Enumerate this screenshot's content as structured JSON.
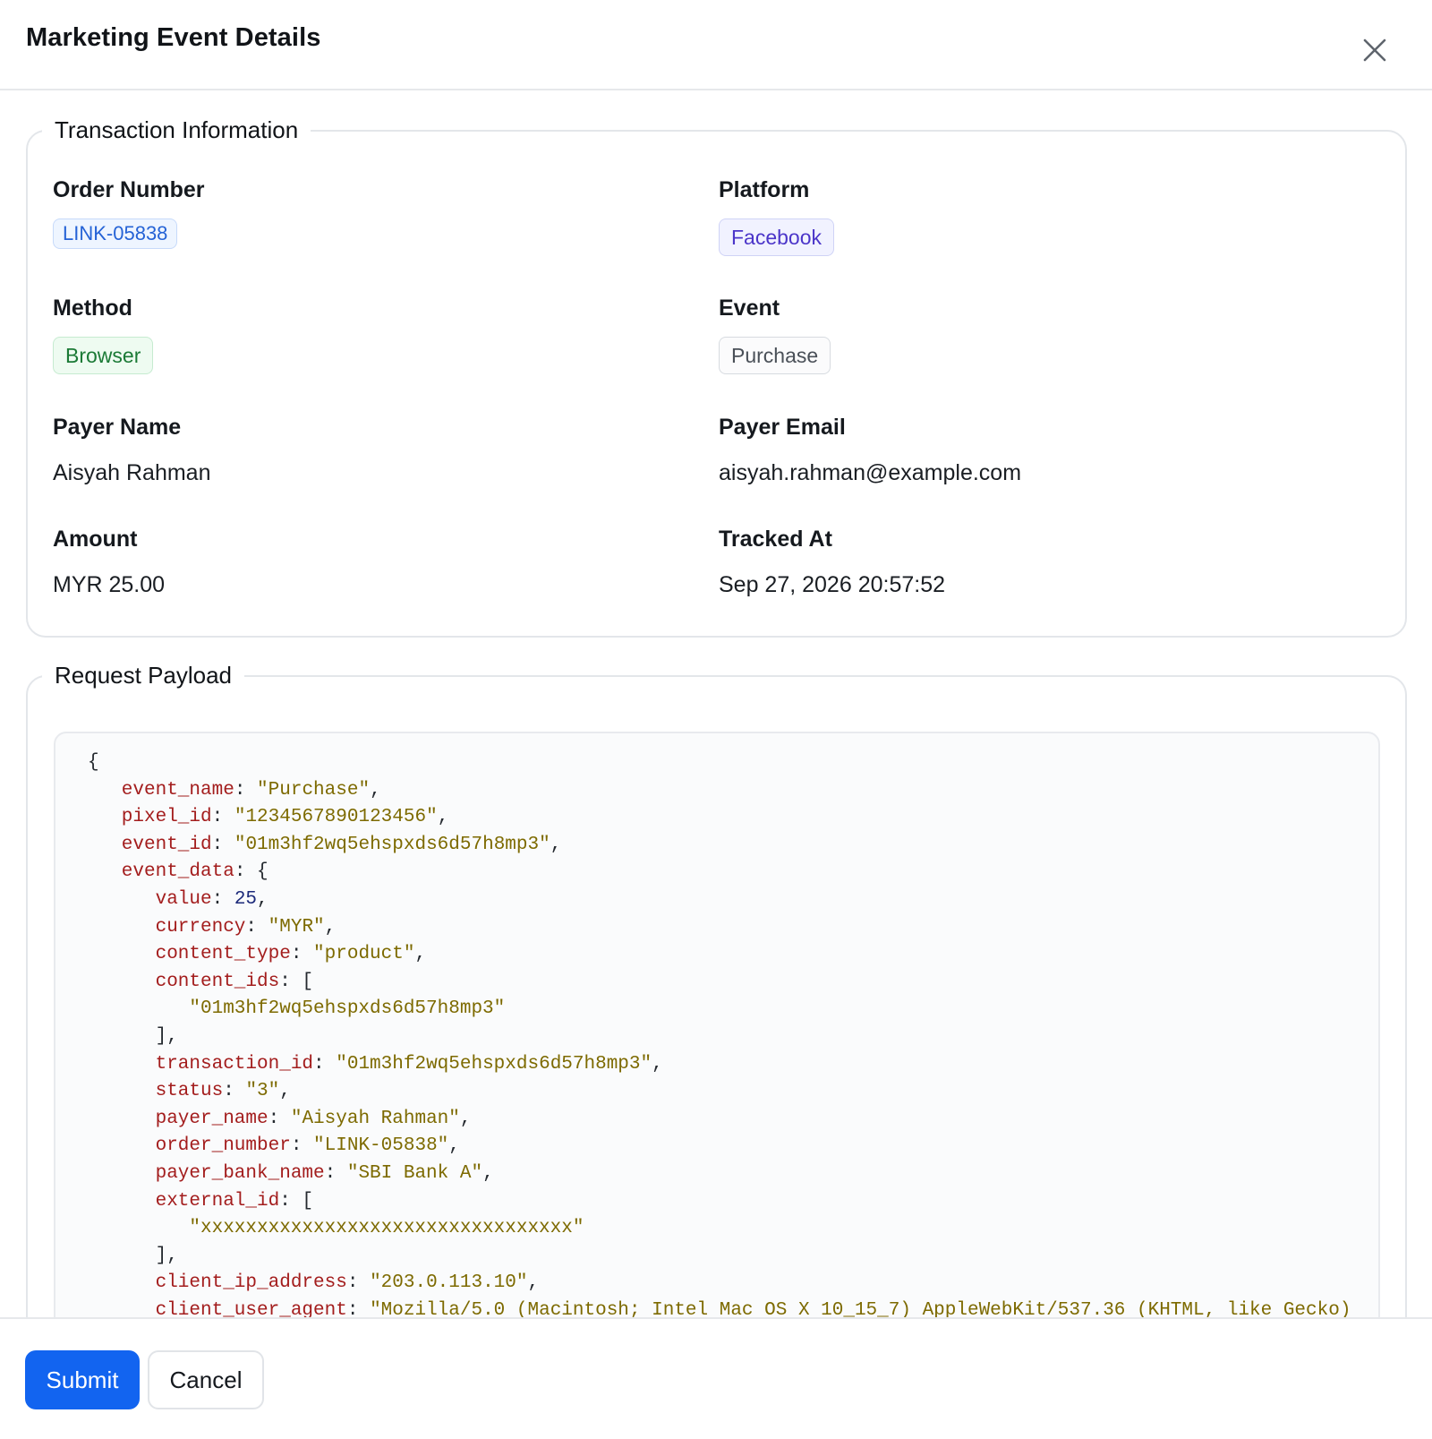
{
  "modal": {
    "title": "Marketing Event Details"
  },
  "transaction": {
    "legend": "Transaction Information",
    "order_number": {
      "label": "Order Number",
      "value": "LINK-05838"
    },
    "platform": {
      "label": "Platform",
      "value": "Facebook"
    },
    "method": {
      "label": "Method",
      "value": "Browser"
    },
    "event": {
      "label": "Event",
      "value": "Purchase"
    },
    "payer_name": {
      "label": "Payer Name",
      "value": "Aisyah Rahman"
    },
    "payer_email": {
      "label": "Payer Email",
      "value": "aisyah.rahman@example.com"
    },
    "amount": {
      "label": "Amount",
      "value": "MYR 25.00"
    },
    "tracked_at": {
      "label": "Tracked At",
      "value": "Sep 27, 2026 20:57:52"
    }
  },
  "payload": {
    "legend": "Request Payload",
    "lines": [
      {
        "indent": 0,
        "parts": [
          [
            "p",
            "{"
          ]
        ]
      },
      {
        "indent": 1,
        "parts": [
          [
            "k",
            "event_name"
          ],
          [
            "p",
            ": "
          ],
          [
            "s",
            "\"Purchase\""
          ],
          [
            "p",
            ","
          ]
        ]
      },
      {
        "indent": 1,
        "parts": [
          [
            "k",
            "pixel_id"
          ],
          [
            "p",
            ": "
          ],
          [
            "s",
            "\"1234567890123456\""
          ],
          [
            "p",
            ","
          ]
        ]
      },
      {
        "indent": 1,
        "parts": [
          [
            "k",
            "event_id"
          ],
          [
            "p",
            ": "
          ],
          [
            "s",
            "\"01m3hf2wq5ehspxds6d57h8mp3\""
          ],
          [
            "p",
            ","
          ]
        ]
      },
      {
        "indent": 1,
        "parts": [
          [
            "k",
            "event_data"
          ],
          [
            "p",
            ": {"
          ]
        ]
      },
      {
        "indent": 2,
        "parts": [
          [
            "k",
            "value"
          ],
          [
            "p",
            ": "
          ],
          [
            "n",
            "25"
          ],
          [
            "p",
            ","
          ]
        ]
      },
      {
        "indent": 2,
        "parts": [
          [
            "k",
            "currency"
          ],
          [
            "p",
            ": "
          ],
          [
            "s",
            "\"MYR\""
          ],
          [
            "p",
            ","
          ]
        ]
      },
      {
        "indent": 2,
        "parts": [
          [
            "k",
            "content_type"
          ],
          [
            "p",
            ": "
          ],
          [
            "s",
            "\"product\""
          ],
          [
            "p",
            ","
          ]
        ]
      },
      {
        "indent": 2,
        "parts": [
          [
            "k",
            "content_ids"
          ],
          [
            "p",
            ": ["
          ]
        ]
      },
      {
        "indent": 3,
        "parts": [
          [
            "s",
            "\"01m3hf2wq5ehspxds6d57h8mp3\""
          ]
        ]
      },
      {
        "indent": 2,
        "parts": [
          [
            "p",
            "],"
          ]
        ]
      },
      {
        "indent": 2,
        "parts": [
          [
            "k",
            "transaction_id"
          ],
          [
            "p",
            ": "
          ],
          [
            "s",
            "\"01m3hf2wq5ehspxds6d57h8mp3\""
          ],
          [
            "p",
            ","
          ]
        ]
      },
      {
        "indent": 2,
        "parts": [
          [
            "k",
            "status"
          ],
          [
            "p",
            ": "
          ],
          [
            "s",
            "\"3\""
          ],
          [
            "p",
            ","
          ]
        ]
      },
      {
        "indent": 2,
        "parts": [
          [
            "k",
            "payer_name"
          ],
          [
            "p",
            ": "
          ],
          [
            "s",
            "\"Aisyah Rahman\""
          ],
          [
            "p",
            ","
          ]
        ]
      },
      {
        "indent": 2,
        "parts": [
          [
            "k",
            "order_number"
          ],
          [
            "p",
            ": "
          ],
          [
            "s",
            "\"LINK-05838\""
          ],
          [
            "p",
            ","
          ]
        ]
      },
      {
        "indent": 2,
        "parts": [
          [
            "k",
            "payer_bank_name"
          ],
          [
            "p",
            ": "
          ],
          [
            "s",
            "\"SBI Bank A\""
          ],
          [
            "p",
            ","
          ]
        ]
      },
      {
        "indent": 2,
        "parts": [
          [
            "k",
            "external_id"
          ],
          [
            "p",
            ": ["
          ]
        ]
      },
      {
        "indent": 3,
        "parts": [
          [
            "s",
            "\"xxxxxxxxxxxxxxxxxxxxxxxxxxxxxxxxx\""
          ]
        ]
      },
      {
        "indent": 2,
        "parts": [
          [
            "p",
            "],"
          ]
        ]
      },
      {
        "indent": 2,
        "parts": [
          [
            "k",
            "client_ip_address"
          ],
          [
            "p",
            ": "
          ],
          [
            "s",
            "\"203.0.113.10\""
          ],
          [
            "p",
            ","
          ]
        ]
      },
      {
        "indent": 2,
        "parts": [
          [
            "k",
            "client_user_agent"
          ],
          [
            "p",
            ": "
          ],
          [
            "s",
            "\"Mozilla/5.0 (Macintosh; Intel Mac OS X 10_15_7) AppleWebKit/537.36 (KHTML, like Gecko)"
          ]
        ]
      }
    ]
  },
  "footer": {
    "submit_label": "Submit",
    "cancel_label": "Cancel"
  },
  "icons": {
    "close": "close-icon"
  }
}
